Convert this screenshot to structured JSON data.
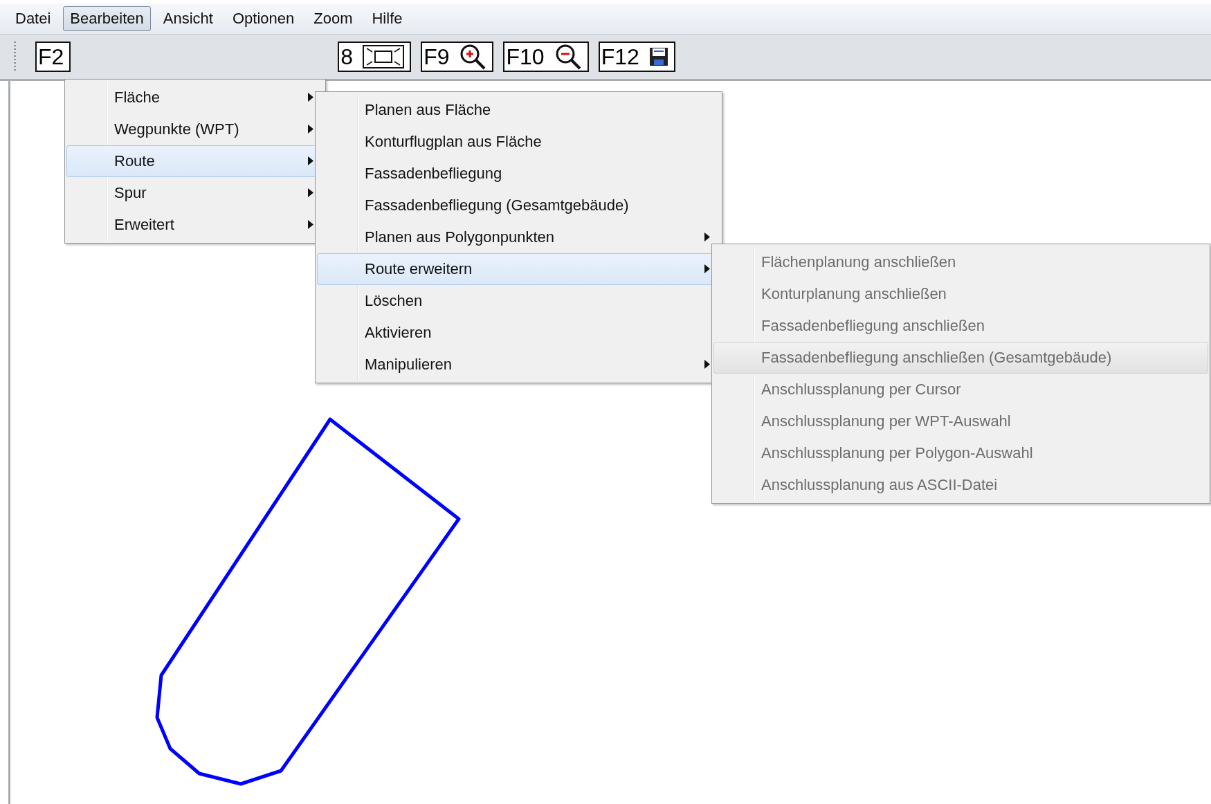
{
  "menu_bar": [
    {
      "label": "Datei",
      "selected": false
    },
    {
      "label": "Bearbeiten",
      "selected": true
    },
    {
      "label": "Ansicht",
      "selected": false
    },
    {
      "label": "Optionen",
      "selected": false
    },
    {
      "label": "Zoom",
      "selected": false
    },
    {
      "label": "Hilfe",
      "selected": false
    }
  ],
  "toolbar": [
    {
      "key": "F2",
      "kind": "plain"
    },
    {
      "key": "8",
      "kind": "fit"
    },
    {
      "key": "F9",
      "kind": "zoom-in"
    },
    {
      "key": "F10",
      "kind": "zoom-out"
    },
    {
      "key": "F12",
      "kind": "save"
    }
  ],
  "menus": [
    {
      "items": [
        {
          "label": "Fläche",
          "submenu": true,
          "selected": false,
          "disabled": false
        },
        {
          "label": "Wegpunkte (WPT)",
          "submenu": true,
          "selected": false,
          "disabled": false
        },
        {
          "label": "Route",
          "submenu": true,
          "selected": true,
          "disabled": false
        },
        {
          "label": "Spur",
          "submenu": true,
          "selected": false,
          "disabled": false
        },
        {
          "label": "Erweitert",
          "submenu": true,
          "selected": false,
          "disabled": false
        }
      ]
    },
    {
      "items": [
        {
          "label": "Planen aus Fläche",
          "submenu": false,
          "selected": false,
          "disabled": false
        },
        {
          "label": "Konturflugplan aus Fläche",
          "submenu": false,
          "selected": false,
          "disabled": false
        },
        {
          "label": "Fassadenbefliegung",
          "submenu": false,
          "selected": false,
          "disabled": false
        },
        {
          "label": "Fassadenbefliegung (Gesamtgebäude)",
          "submenu": false,
          "selected": false,
          "disabled": false
        },
        {
          "label": "Planen aus Polygonpunkten",
          "submenu": true,
          "selected": false,
          "disabled": false
        },
        {
          "label": "Route erweitern",
          "submenu": true,
          "selected": true,
          "disabled": false
        },
        {
          "label": "Löschen",
          "submenu": false,
          "selected": false,
          "disabled": false
        },
        {
          "label": "Aktivieren",
          "submenu": false,
          "selected": false,
          "disabled": false
        },
        {
          "label": "Manipulieren",
          "submenu": true,
          "selected": false,
          "disabled": false
        }
      ]
    },
    {
      "items": [
        {
          "label": "Flächenplanung anschließen",
          "submenu": false,
          "selected": false,
          "disabled": true
        },
        {
          "label": "Konturplanung anschließen",
          "submenu": false,
          "selected": false,
          "disabled": true
        },
        {
          "label": "Fassadenbefliegung anschließen",
          "submenu": false,
          "selected": false,
          "disabled": true
        },
        {
          "label": "Fassadenbefliegung anschließen (Gesamtgebäude)",
          "submenu": false,
          "selected": true,
          "disabled": true
        },
        {
          "label": "Anschlussplanung per Cursor",
          "submenu": false,
          "selected": false,
          "disabled": true
        },
        {
          "label": "Anschlussplanung per WPT-Auswahl",
          "submenu": false,
          "selected": false,
          "disabled": true
        },
        {
          "label": "Anschlussplanung per Polygon-Auswahl",
          "submenu": false,
          "selected": false,
          "disabled": true
        },
        {
          "label": "Anschlussplanung aus ASCII-Datei",
          "submenu": false,
          "selected": false,
          "disabled": true
        }
      ]
    }
  ]
}
